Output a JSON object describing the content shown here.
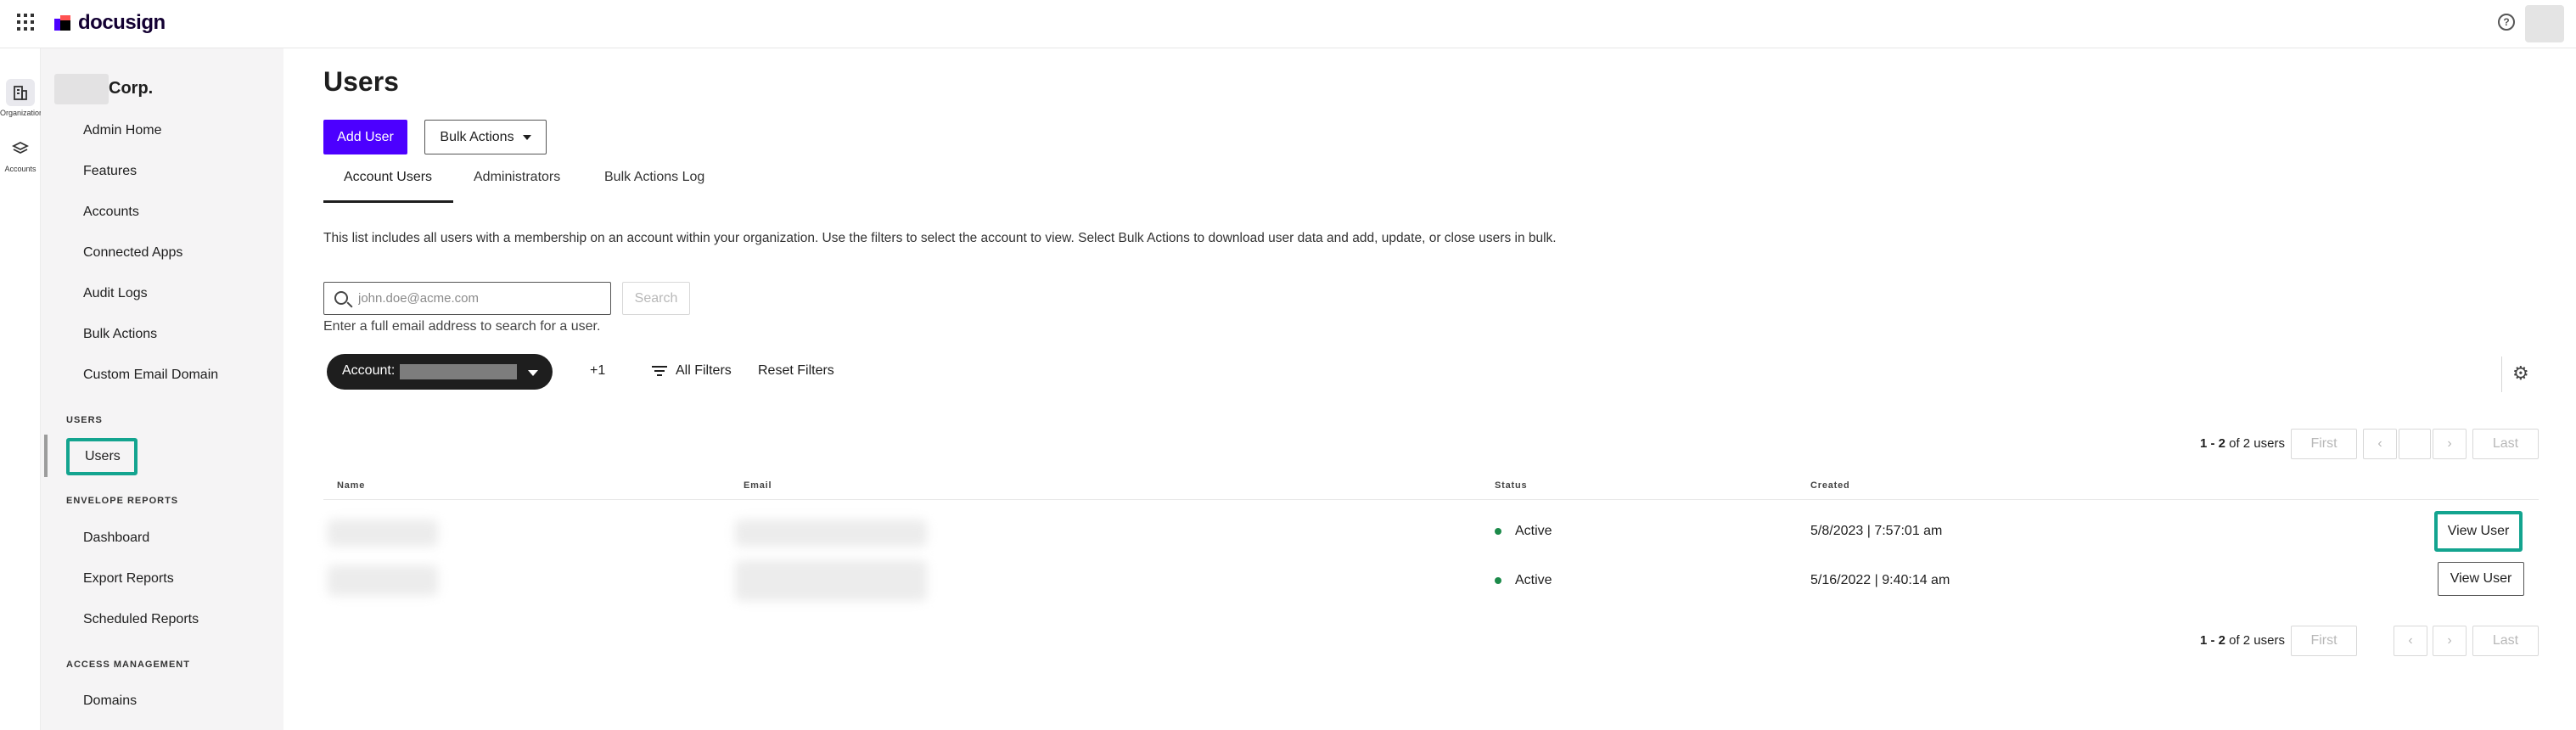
{
  "app": {
    "brand": "docusign"
  },
  "rail": {
    "items": [
      {
        "label": "Organization",
        "icon": "building-icon",
        "active": true
      },
      {
        "label": "Accounts",
        "icon": "layers-icon",
        "active": false
      }
    ]
  },
  "sidebar": {
    "org_name": "Corp.",
    "items": [
      "Admin Home",
      "Features",
      "Accounts",
      "Connected Apps",
      "Audit Logs",
      "Bulk Actions",
      "Custom Email Domain"
    ],
    "sections": {
      "users": {
        "title": "USERS",
        "items": [
          "Users"
        ]
      },
      "envelope_reports": {
        "title": "ENVELOPE REPORTS",
        "items": [
          "Dashboard",
          "Export Reports",
          "Scheduled Reports"
        ]
      },
      "access_management": {
        "title": "ACCESS MANAGEMENT",
        "items": [
          "Domains"
        ]
      }
    },
    "active_item": "Users"
  },
  "main": {
    "title": "Users",
    "add_user_label": "Add User",
    "bulk_actions_label": "Bulk Actions",
    "tabs": [
      {
        "label": "Account Users",
        "active": true
      },
      {
        "label": "Administrators",
        "active": false
      },
      {
        "label": "Bulk Actions Log",
        "active": false
      }
    ],
    "description": "This list includes all users with a membership on an account within your organization. Use the filters to select the account to view. Select Bulk Actions to download user data and add, update, or close users in bulk.",
    "search": {
      "placeholder": "john.doe@acme.com",
      "value": "",
      "button_label": "Search",
      "hint": "Enter a full email address to search for a user."
    },
    "filters": {
      "account_label": "Account:",
      "extra_count": "+1",
      "all_filters_label": "All Filters",
      "reset_label": "Reset Filters"
    },
    "pagination": {
      "range": "1 - 2",
      "total": "of 2 users",
      "first": "First",
      "prev": "‹",
      "next": "›",
      "last": "Last"
    },
    "table": {
      "columns": [
        "Name",
        "Email",
        "Status",
        "Created"
      ],
      "rows": [
        {
          "status": "Active",
          "created": "5/8/2023 | 7:57:01 am",
          "action": "View User"
        },
        {
          "status": "Active",
          "created": "5/16/2022 | 9:40:14 am",
          "action": "View User"
        }
      ]
    }
  },
  "colors": {
    "primary": "#4c00ff",
    "highlight": "#13a48f",
    "status_active": "#1c8a4a",
    "sidebar_bg": "#f5f4f5"
  }
}
